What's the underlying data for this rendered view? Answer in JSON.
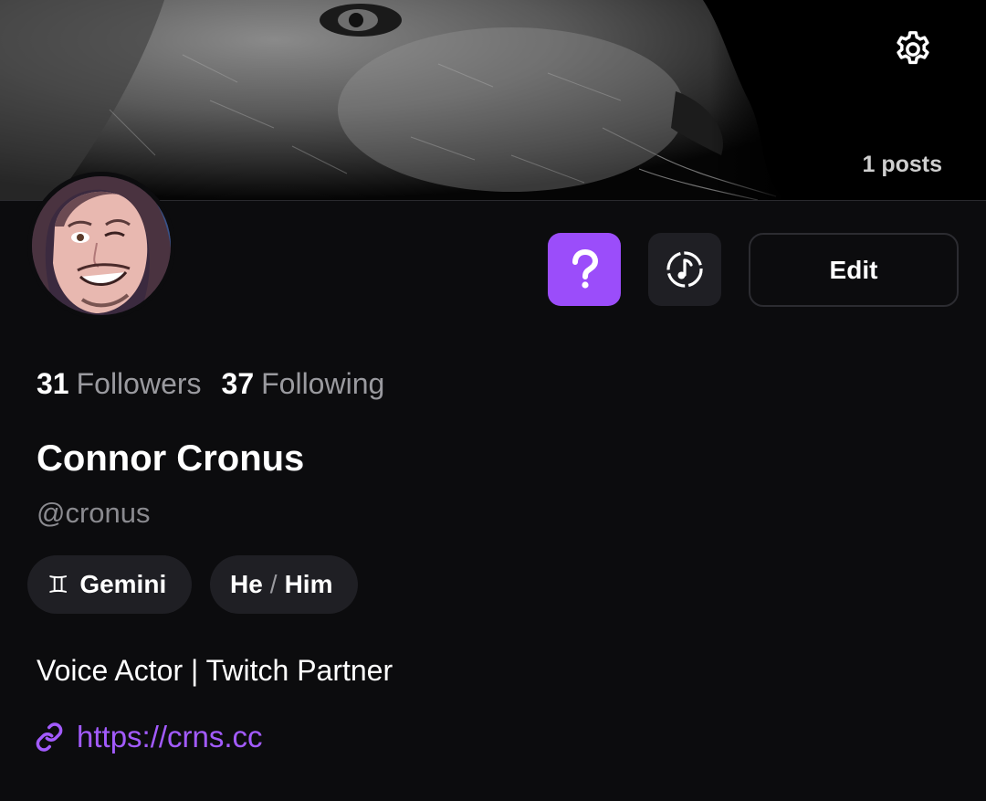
{
  "banner": {
    "posts_label": "1 posts"
  },
  "profile": {
    "followers_count": "31",
    "followers_label": "Followers",
    "following_count": "37",
    "following_label": "Following",
    "display_name": "Connor Cronus",
    "handle": "@cronus",
    "zodiac_glyph": "♊",
    "zodiac": "Gemini",
    "pronoun_subject": "He",
    "pronoun_sep": "/",
    "pronoun_object": "Him",
    "bio": "Voice Actor | Twitch Partner",
    "link": "https://crns.cc"
  },
  "actions": {
    "help_icon": "question-mark-icon",
    "music_icon": "music-note-icon",
    "edit_label": "Edit",
    "settings_icon": "gear-icon"
  },
  "colors": {
    "accent": "#9b4dfa",
    "link": "#a35bff",
    "background": "#0c0c0e",
    "chip": "#1f1f24"
  }
}
